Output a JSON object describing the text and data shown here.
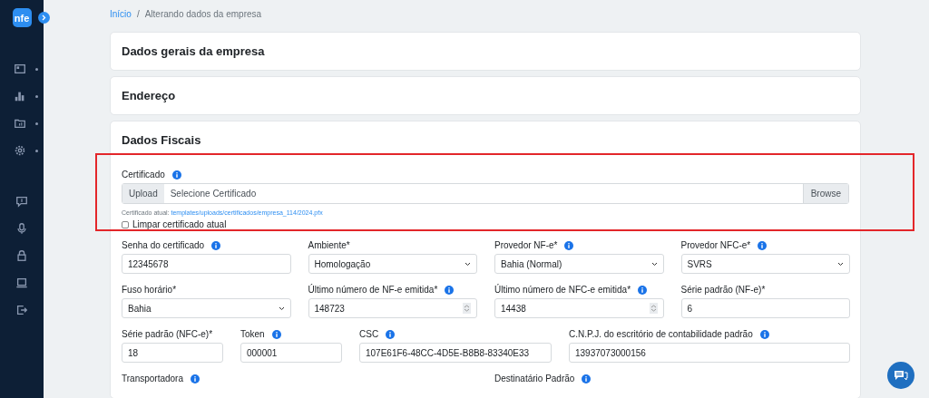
{
  "breadcrumb": {
    "link": "Início",
    "separator": "/",
    "current": "Alterando dados da empresa"
  },
  "sidebar": {
    "logo": "nfe",
    "groups": [
      [
        {
          "kind": "menu"
        },
        {
          "kind": "menu"
        },
        {
          "kind": "menu"
        },
        {
          "kind": "menu"
        }
      ],
      [
        {
          "kind": "utility"
        },
        {
          "kind": "utility"
        },
        {
          "kind": "utility"
        },
        {
          "kind": "utility"
        },
        {
          "kind": "utility"
        }
      ]
    ]
  },
  "sections": [
    {
      "title": "Dados gerais da empresa",
      "expanded": false
    },
    {
      "title": "Endereço",
      "expanded": false
    },
    {
      "title": "Dados Fiscais",
      "expanded": true
    }
  ],
  "certificate": {
    "label": "Certificado",
    "info": true,
    "upload_label": "Upload",
    "placeholder": "Selecione Certificado",
    "browse": "Browse",
    "current_label": "Certificado atual:",
    "current_link": "templates/uploads/certificados/empresa_114/2024.pfx",
    "clear_label": "Limpar certificado atual",
    "clear_checked": false,
    "highlighted": true
  },
  "rows": [
    [
      {
        "label": "Senha do certificado",
        "info": true,
        "kind": "text",
        "value": "12345678"
      },
      {
        "label": "Ambiente*",
        "info": false,
        "kind": "select",
        "value": "Homologação"
      },
      {
        "label": "Provedor NF-e*",
        "info": true,
        "kind": "select",
        "value": "Bahia (Normal)"
      },
      {
        "label": "Provedor NFC-e*",
        "info": true,
        "kind": "select",
        "value": "SVRS"
      }
    ],
    [
      {
        "label": "Fuso horário*",
        "info": false,
        "kind": "select",
        "value": "Bahia"
      },
      {
        "label": "Último número de NF-e emitida*",
        "info": true,
        "kind": "number",
        "value": "148723"
      },
      {
        "label": "Último número de NFC-e emitida*",
        "info": true,
        "kind": "number",
        "value": "14438"
      },
      {
        "label": "Série padrão (NF-e)*",
        "info": false,
        "kind": "text",
        "value": "6"
      }
    ],
    [
      {
        "label": "Série padrão (NFC-e)*",
        "info": false,
        "kind": "text",
        "value": "18"
      },
      {
        "label": "Token",
        "info": true,
        "kind": "text",
        "value": "000001"
      },
      {
        "label": "CSC",
        "info": true,
        "kind": "text",
        "value": "107E61F6-48CC-4D5E-B8B8-83340E33"
      },
      {
        "label": "C.N.P.J. do escritório de contabilidade padrão",
        "info": true,
        "kind": "text",
        "value": "13937073000156"
      }
    ],
    [
      {
        "label": "Transportadora",
        "info": true,
        "kind": "label"
      },
      {
        "label": "Destinatário Padrão",
        "info": true,
        "kind": "label"
      }
    ]
  ]
}
